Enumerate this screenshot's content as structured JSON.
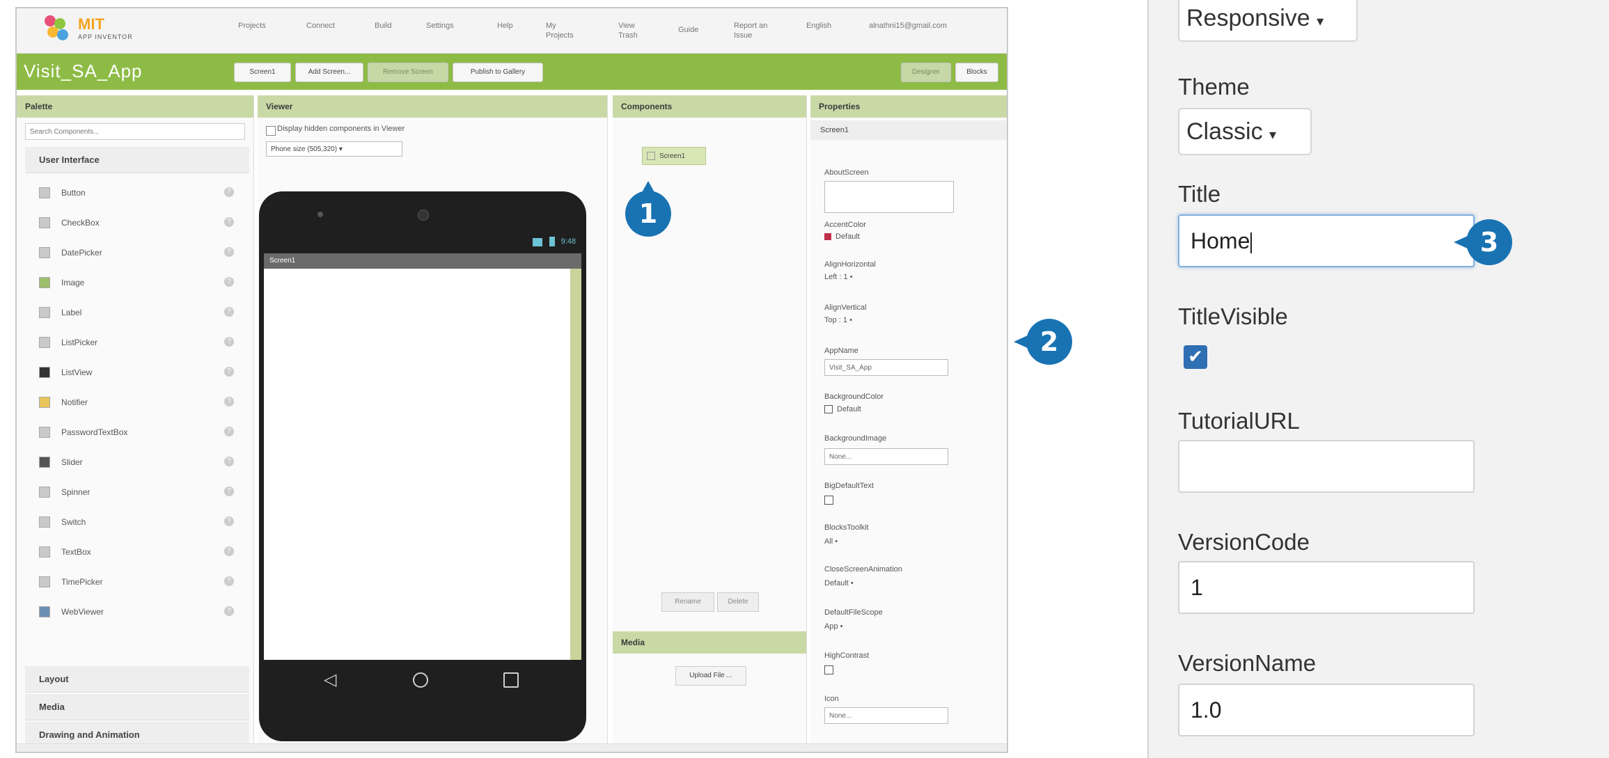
{
  "left": {
    "logo": {
      "brand": "MIT",
      "sub": "APP INVENTOR"
    },
    "nav": [
      "Projects",
      "Connect",
      "Build",
      "Settings",
      "Help",
      "My Projects",
      "View Trash",
      "Guide",
      "Report an Issue",
      "English",
      "alnathni15@gmail.com"
    ],
    "app_name": "Visit_SA_App",
    "toolbar": {
      "screen": "Screen1",
      "add_screen": "Add Screen...",
      "remove_screen": "Remove Screen",
      "gallery": "Publish to Gallery",
      "designer": "Designer",
      "blocks": "Blocks"
    },
    "palette": {
      "title": "Palette",
      "search_placeholder": "Search Components...",
      "category": "User Interface",
      "items": [
        "Button",
        "CheckBox",
        "DatePicker",
        "Image",
        "Label",
        "ListPicker",
        "ListView",
        "Notifier",
        "PasswordTextBox",
        "Slider",
        "Spinner",
        "Switch",
        "TextBox",
        "TimePicker",
        "WebViewer"
      ],
      "bottom_categories": [
        "Layout",
        "Media",
        "Drawing and Animation"
      ]
    },
    "viewer": {
      "title": "Viewer",
      "checkbox_label": "Display hidden components in Viewer",
      "size_select": "Phone size (505,320)",
      "status_time": "9:48",
      "screen_title": "Screen1"
    },
    "components": {
      "title": "Components",
      "root": "Screen1",
      "rename": "Rename",
      "delete": "Delete",
      "media_title": "Media",
      "upload": "Upload File ..."
    },
    "properties": {
      "title": "Properties",
      "screen": "Screen1",
      "items": [
        {
          "label": "AboutScreen",
          "value": ""
        },
        {
          "label": "AccentColor",
          "value": "Default"
        },
        {
          "label": "AlignHorizontal",
          "value": "Left : 1 •"
        },
        {
          "label": "AlignVertical",
          "value": "Top : 1 •"
        },
        {
          "label": "AppName",
          "value": "Visit_SA_App"
        },
        {
          "label": "BackgroundColor",
          "value": "Default"
        },
        {
          "label": "BackgroundImage",
          "value": "None..."
        },
        {
          "label": "BigDefaultText",
          "value": ""
        },
        {
          "label": "BlocksToolkit",
          "value": "All •"
        },
        {
          "label": "CloseScreenAnimation",
          "value": "Default •"
        },
        {
          "label": "DefaultFileScope",
          "value": "App •"
        },
        {
          "label": "HighContrast",
          "value": ""
        },
        {
          "label": "Icon",
          "value": "None..."
        }
      ]
    },
    "callouts": [
      "1",
      "2"
    ]
  },
  "right": {
    "sizing_value": "Responsive",
    "theme_label": "Theme",
    "theme_value": "Classic",
    "title_label": "Title",
    "title_value": "Home",
    "titlevisible_label": "TitleVisible",
    "tutorial_label": "TutorialURL",
    "tutorial_value": "",
    "versioncode_label": "VersionCode",
    "versioncode_value": "1",
    "versionname_label": "VersionName",
    "versionname_value": "1.0",
    "callout": "3"
  },
  "colors": {
    "green": "#8dbb45",
    "callout": "#1973b3",
    "panel_head": "#c9d9a6"
  }
}
